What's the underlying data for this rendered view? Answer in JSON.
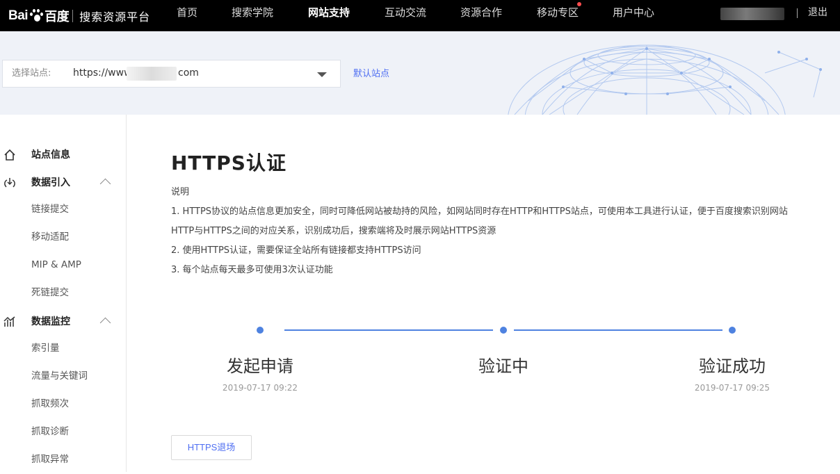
{
  "header": {
    "logo_bai": "Bai",
    "logo_du": "百度",
    "platform_name": "搜索资源平台",
    "nav": [
      {
        "label": "首页",
        "active": false
      },
      {
        "label": "搜索学院",
        "active": false
      },
      {
        "label": "网站支持",
        "active": true
      },
      {
        "label": "互动交流",
        "active": false
      },
      {
        "label": "资源合作",
        "active": false
      },
      {
        "label": "移动专区",
        "active": false,
        "notification_dot": true
      },
      {
        "label": "用户中心",
        "active": false
      }
    ],
    "divider": "|",
    "logout": "退出"
  },
  "site_selector": {
    "label": "选择站点:",
    "value_prefix": "https://www.",
    "value_suffix": "com",
    "default_site_link": "默认站点"
  },
  "sidebar": {
    "sections": [
      {
        "title": "站点信息",
        "icon": "home-icon",
        "expandable": false,
        "items": []
      },
      {
        "title": "数据引入",
        "icon": "data-import-icon",
        "expandable": true,
        "items": [
          "链接提交",
          "移动适配",
          "MIP & AMP",
          "死链提交"
        ]
      },
      {
        "title": "数据监控",
        "icon": "chart-icon",
        "expandable": true,
        "items": [
          "索引量",
          "流量与关键词",
          "抓取频次",
          "抓取诊断",
          "抓取异常"
        ]
      }
    ]
  },
  "main": {
    "title": "HTTPS认证",
    "description": {
      "heading": "说明",
      "lines": [
        "1. HTTPS协议的站点信息更加安全，同时可降低网站被劫持的风险，如网站同时存在HTTP和HTTPS站点，可使用本工具进行认证，便于百度搜索识别网站",
        "HTTP与HTTPS之间的对应关系，识别成功后，搜索端将及时展示网站HTTPS资源",
        "2. 使用HTTPS认证，需要保证全站所有链接都支持HTTPS访问",
        "3. 每个站点每天最多可使用3次认证功能"
      ]
    },
    "steps": [
      {
        "label": "发起申请",
        "time": "2019-07-17 09:22"
      },
      {
        "label": "验证中",
        "time": ""
      },
      {
        "label": "验证成功",
        "time": "2019-07-17 09:25"
      }
    ],
    "exit_button": "HTTPS退场"
  },
  "colors": {
    "nav_bg": "#000000",
    "banner_bg": "#eff2f8",
    "accent_blue": "#4e82e0",
    "link_blue": "#4e6ef2",
    "notification_red": "#ff4d4f"
  }
}
